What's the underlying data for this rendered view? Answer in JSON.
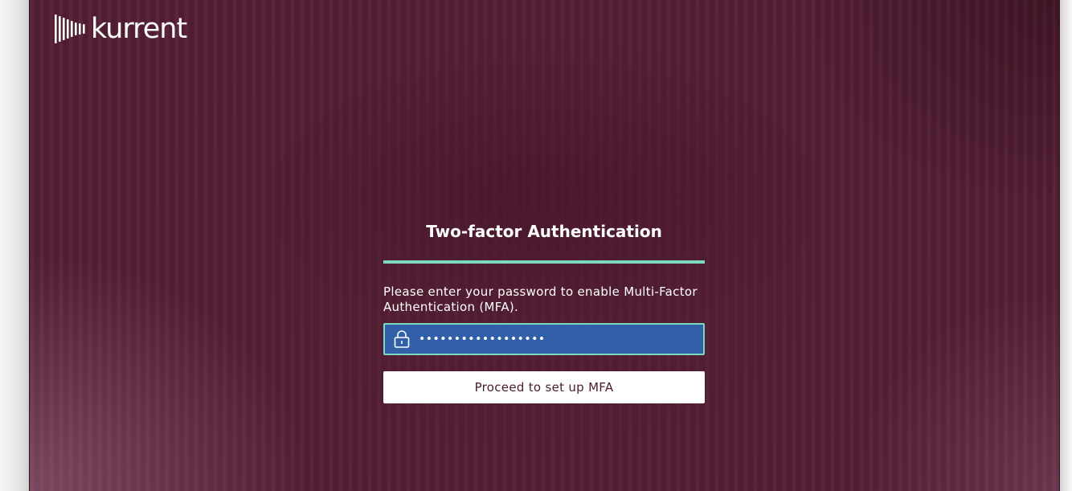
{
  "brand": {
    "name": "kurrent",
    "logo_icon": "kurrent-wave-logo-icon"
  },
  "mfa": {
    "title": "Two-factor Authentication",
    "description": "Please enter your password to enable Multi-Factor Authentication (MFA).",
    "password": {
      "icon": "lock-icon",
      "value": "••••••••••••••••••"
    },
    "proceed_label": "Proceed to set up MFA"
  },
  "colors": {
    "background": "#521e33",
    "accent": "#7ad9c0",
    "input_fill": "#3160a8",
    "button_text": "#4a1a2e"
  }
}
